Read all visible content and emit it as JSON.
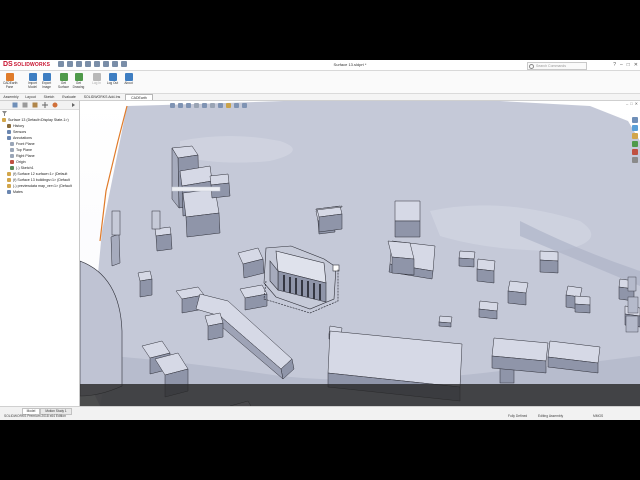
{
  "app": {
    "logo_text": "SOLIDWORKS",
    "logo_mark": "DS",
    "document_title": "Surface 13.sldprt *",
    "search_placeholder": "Search Commands",
    "window_controls": [
      "?",
      "–",
      "□",
      "✕"
    ]
  },
  "ribbon": {
    "buttons": [
      {
        "label": "CADEarth Pane",
        "color": "#e07b2a"
      },
      {
        "label": "Import Model",
        "color": "#3e7ec2"
      },
      {
        "label": "Export Image",
        "color": "#3e7ec2"
      },
      {
        "label": "Get Surface",
        "color": "#4f9a4a"
      },
      {
        "label": "Get Drawing",
        "color": "#4f9a4a"
      },
      {
        "label": "Log In",
        "color": "#b8b8b8"
      },
      {
        "label": "Log Out",
        "color": "#3e7ec2"
      },
      {
        "label": "About",
        "color": "#3e7ec2"
      }
    ]
  },
  "tabs": [
    {
      "label": "Assembly"
    },
    {
      "label": "Layout"
    },
    {
      "label": "Sketch"
    },
    {
      "label": "Evaluate"
    },
    {
      "label": "SOLIDWORKS Add-Ins"
    },
    {
      "label": "CADEarth"
    }
  ],
  "tree": {
    "root": "Surface 13 (Default<Display State-1>)",
    "items": [
      {
        "label": "History",
        "color": "#8a6b3a"
      },
      {
        "label": "Sensors",
        "color": "#6a86b0"
      },
      {
        "label": "Annotations",
        "color": "#6a86b0"
      },
      {
        "label": "Front Plane",
        "color": "#9aa6b8"
      },
      {
        "label": "Top Plane",
        "color": "#9aa6b8"
      },
      {
        "label": "Right Plane",
        "color": "#9aa6b8"
      },
      {
        "label": "Origin",
        "color": "#c05040"
      },
      {
        "label": "(-) Sketch1",
        "color": "#5a8a5a"
      },
      {
        "label": "(f) Surface 12 surface<1> (Default",
        "color": "#d2a64b"
      },
      {
        "label": "(f) Surface 13 buildings<1> (Default",
        "color": "#d2a64b"
      },
      {
        "label": "(-) previewdata map_ver<1> (Default",
        "color": "#d2a64b"
      },
      {
        "label": "Mates",
        "color": "#6a86b0"
      }
    ]
  },
  "model_tabs": [
    "Model",
    "Motion Study 1"
  ],
  "status": {
    "left": "SOLIDWORKS Premium 2018 x64 Edition",
    "right_items": [
      "Fully Defined",
      "Editing Assembly",
      "MMGS"
    ]
  },
  "colors": {
    "terrain": "#c6cad8",
    "building_top": "#d6d9e6",
    "building_side": "#8f95a9",
    "edge": "#2e2f38",
    "highlight": "#e07b2a"
  }
}
